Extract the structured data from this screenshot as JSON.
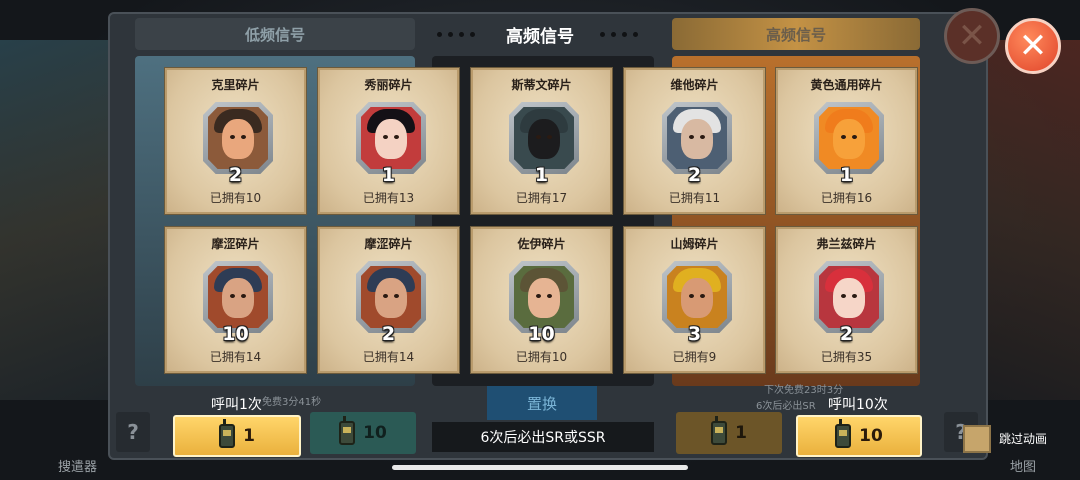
{
  "tabs": {
    "low_signal": "低频信号",
    "high_signal_center": "高频信号",
    "high_signal_right": "高频信号"
  },
  "cards": [
    {
      "name": "克里碎片",
      "count": "2",
      "owned": "已拥有10",
      "skin": "#e9a77d",
      "hair": "#3a2a20",
      "bg": "#8c5a3a",
      "icon": "bald-man-portrait"
    },
    {
      "name": "秀丽碎片",
      "count": "1",
      "owned": "已拥有13",
      "skin": "#f4d2c3",
      "hair": "#141016",
      "bg": "#c23c3c",
      "icon": "dark-hair-woman-portrait"
    },
    {
      "name": "斯蒂文碎片",
      "count": "1",
      "owned": "已拥有17",
      "skin": "#1c1c1e",
      "hair": "#2e3b3f",
      "bg": "#394a4e",
      "icon": "masked-soldier-portrait"
    },
    {
      "name": "维他碎片",
      "count": "2",
      "owned": "已拥有11",
      "skin": "#d8b9a2",
      "hair": "#e3e3e3",
      "bg": "#4d5f73",
      "icon": "old-man-portrait"
    },
    {
      "name": "黄色通用碎片",
      "count": "1",
      "owned": "已拥有16",
      "skin": "#f7a13a",
      "hair": "#f07c1c",
      "bg": "#f08a24",
      "icon": "generic-silhouette-icon"
    },
    {
      "name": "摩涩碎片",
      "count": "10",
      "owned": "已拥有14",
      "skin": "#d9a383",
      "hair": "#2e3c55",
      "bg": "#a04a2c",
      "icon": "cap-soldier-portrait"
    },
    {
      "name": "摩涩碎片",
      "count": "2",
      "owned": "已拥有14",
      "skin": "#d9a383",
      "hair": "#2e3c55",
      "bg": "#a04a2c",
      "icon": "cap-soldier-portrait"
    },
    {
      "name": "佐伊碎片",
      "count": "10",
      "owned": "已拥有10",
      "skin": "#e6b493",
      "hair": "#5c5436",
      "bg": "#5a6c3e",
      "icon": "pilot-helmet-portrait"
    },
    {
      "name": "山姆碎片",
      "count": "3",
      "owned": "已拥有9",
      "skin": "#d89a74",
      "hair": "#e0b020",
      "bg": "#c9821f",
      "icon": "hardhat-worker-portrait"
    },
    {
      "name": "弗兰兹碎片",
      "count": "2",
      "owned": "已拥有35",
      "skin": "#f6d6c8",
      "hair": "#d8303c",
      "bg": "#b8363e",
      "icon": "red-hair-woman-portrait"
    }
  ],
  "controls": {
    "call_once_label": "呼叫1次",
    "call_once_cost": "1",
    "call_ten_label": "呼叫10次",
    "call_ten_cost": "10",
    "left_dim_cost": "10",
    "right_dim_cost": "1",
    "replace_label": "置换",
    "pity_text": "6次后必出SR或SSR",
    "left_timer": "免费3分41秒",
    "right_timer": "下次免费23时3分",
    "right_pity_small": "6次后必出SR",
    "question_mark": "?",
    "skip_animation_label": "跳过动画",
    "close_symbol": "✕",
    "left_corner_label": "搜遣器",
    "right_corner_label": "地图"
  }
}
